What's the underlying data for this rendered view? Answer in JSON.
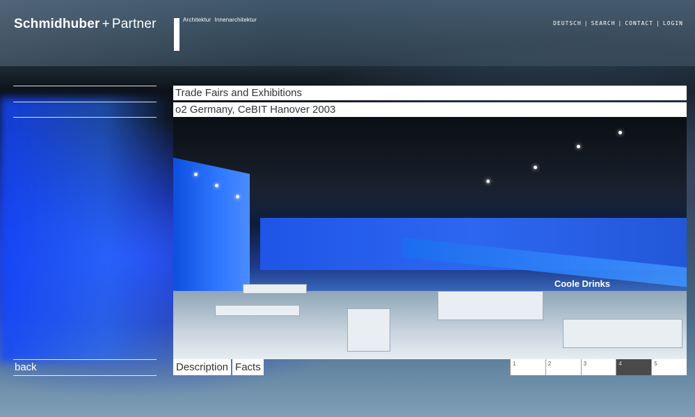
{
  "brand": {
    "name_bold": "Schmidhuber",
    "plus": "+",
    "name_light": "Partner",
    "tagline_1": "Architektur",
    "tagline_2": "Innenarchitektur"
  },
  "topnav": {
    "deutsch": "DEUTSCH",
    "search": "SEARCH",
    "contact": "CONTACT",
    "login": "LOGIN",
    "separator": "|"
  },
  "content": {
    "category": "Trade Fairs and Exhibitions",
    "project": "o2 Germany, CeBIT Hanover 2003",
    "banner_text": "Coole Drinks"
  },
  "sidebar": {
    "back_label": "back"
  },
  "tabs": {
    "description": "Description",
    "facts": "Facts"
  },
  "pager": {
    "pages": [
      "1",
      "2",
      "3",
      "4",
      "5"
    ],
    "active_index": 3
  },
  "colors": {
    "accent_blue": "#2f6bff",
    "white": "#ffffff",
    "pager_active": "#4a4a4a"
  }
}
